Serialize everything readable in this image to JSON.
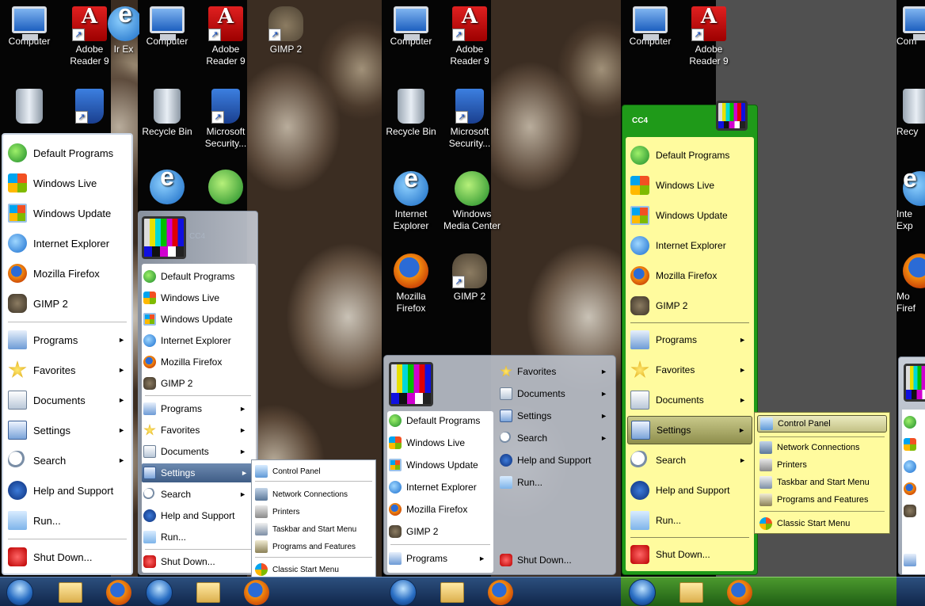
{
  "desktop_icons": {
    "computer": "Computer",
    "adobe_reader": "Adobe Reader 9",
    "gimp": "GIMP 2",
    "recycle_bin": "Recycle Bin",
    "ms_security": "Microsoft Security...",
    "internet_explorer": "Internet Explorer",
    "windows_media_center": "Windows Media Center",
    "mozilla_firefox": "Mozilla Firefox",
    "edge_com": "Com",
    "edge_recy": "Recy",
    "edge_inte": "Inte Exp",
    "edge_mo": "Mo Firef",
    "edge_ie_partial": "Ir Ex"
  },
  "start_menu": {
    "default_programs": "Default Programs",
    "windows_live": "Windows Live",
    "windows_update": "Windows Update",
    "internet_explorer": "Internet Explorer",
    "mozilla_firefox": "Mozilla Firefox",
    "gimp": "GIMP 2",
    "programs": "Programs",
    "favorites": "Favorites",
    "documents": "Documents",
    "settings": "Settings",
    "search": "Search",
    "help_and_support": "Help and Support",
    "run": "Run...",
    "shut_down": "Shut Down...",
    "arrow": "►",
    "user_name": "CC4"
  },
  "settings_submenu": {
    "control_panel": "Control Panel",
    "network_connections": "Network Connections",
    "printers": "Printers",
    "taskbar_and_start_menu": "Taskbar and Start Menu",
    "programs_and_features": "Programs and Features",
    "classic_start_menu": "Classic Start Menu"
  },
  "colors": {
    "green_frame": "#1f9a19",
    "yellow_panel": "#fffb9e",
    "taskbar_blue": "#1b3a66",
    "taskbar_green": "#2e7d1e"
  }
}
